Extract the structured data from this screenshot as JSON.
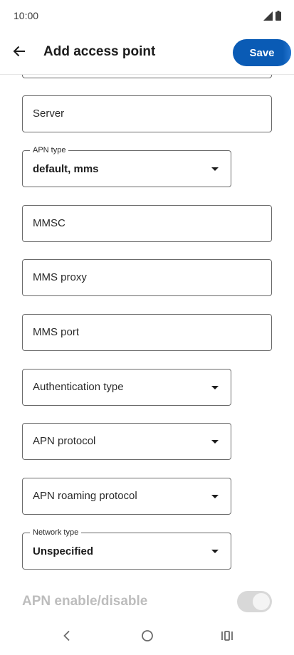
{
  "status_bar": {
    "time": "10:00",
    "icons": [
      "signal-icon",
      "battery-icon"
    ]
  },
  "app_bar": {
    "title": "Add access point",
    "save_label": "Save",
    "back_icon": "arrow-back-icon"
  },
  "fields": {
    "server": {
      "placeholder": "Server"
    },
    "apn_type": {
      "label": "APN type",
      "value": "default, mms"
    },
    "mmsc": {
      "placeholder": "MMSC"
    },
    "mms_proxy": {
      "placeholder": "MMS proxy"
    },
    "mms_port": {
      "placeholder": "MMS port"
    },
    "authentication_type": {
      "placeholder": "Authentication type"
    },
    "apn_protocol": {
      "placeholder": "APN protocol"
    },
    "apn_roaming_protocol": {
      "placeholder": "APN roaming protocol"
    },
    "network_type": {
      "label": "Network type",
      "value": "Unspecified"
    }
  },
  "apn_enable": {
    "label": "APN enable/disable",
    "enabled": false,
    "toggle_on": true
  },
  "nav_bar": {
    "icons": [
      "nav-back-icon",
      "nav-home-icon",
      "nav-recents-icon"
    ]
  },
  "colors": {
    "accent": "#0a5bb5",
    "border": "#6b6b6b",
    "disabled_text": "#bdbdbd"
  }
}
